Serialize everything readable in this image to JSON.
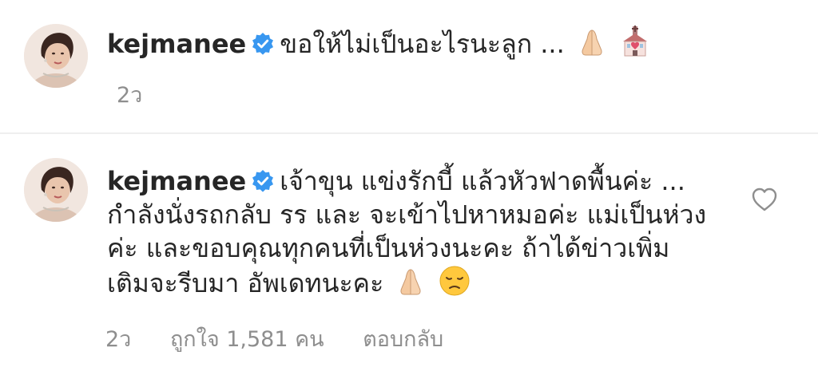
{
  "comments": [
    {
      "username": "kejmanee",
      "text_lines": [
        "ขอให้ไม่เป็นอะไรนะลูก ..."
      ],
      "emojis": [
        "folded-hands",
        "wedding-chapel"
      ],
      "time": "2ว",
      "likes": "",
      "reply": ""
    },
    {
      "username": "kejmanee",
      "text_lines": [
        "เจ้าขุน แข่งรักบี้ แล้วหัวฟาดพื้นค่ะ ...",
        "กำลังนั่งรถกลับ รร และ จะเข้าไปหาหมอค่ะ แม่เป็นห่วง",
        "ค่ะ และขอบคุณทุกคนที่เป็นห่วงนะคะ ถ้าได้ข่าวเพิ่ม",
        "เติมจะรีบมา อัพเดทนะคะ"
      ],
      "emojis": [
        "folded-hands",
        "disappointed-face"
      ],
      "time": "2ว",
      "likes": "ถูกใจ 1,581 คน",
      "reply": "ตอบกลับ"
    }
  ],
  "colors": {
    "text": "#262626",
    "meta": "#8e8e8e",
    "verified": "#3897f0",
    "divider": "#efefef"
  }
}
